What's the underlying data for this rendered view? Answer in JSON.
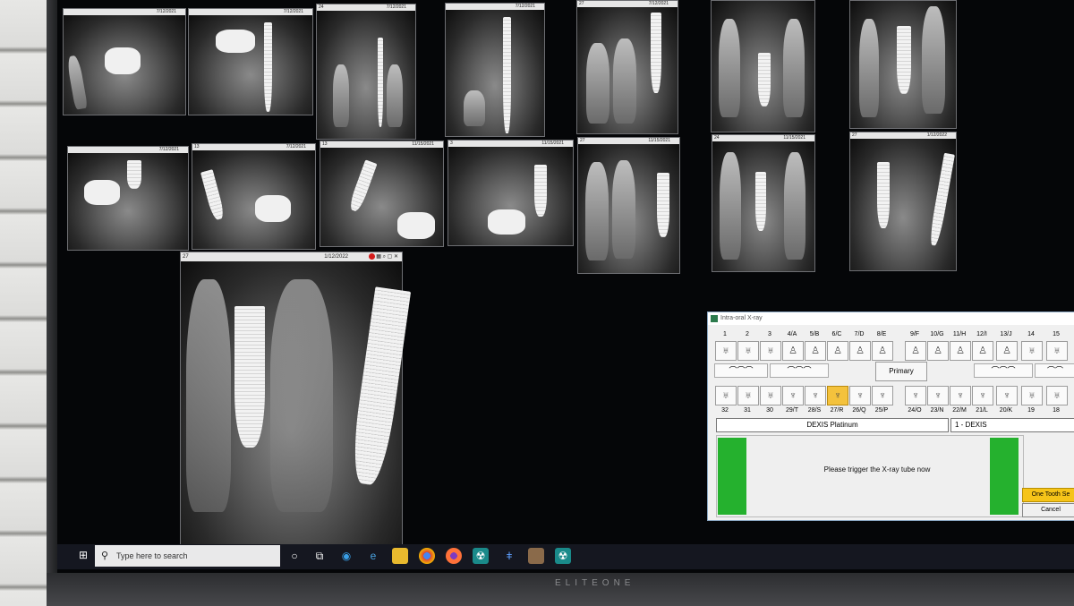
{
  "xrays_top": [
    {
      "tooth": "",
      "date": "7/12/2021"
    },
    {
      "tooth": "",
      "date": "7/12/2021"
    },
    {
      "tooth": "24",
      "date": "7/12/2021"
    },
    {
      "tooth": "",
      "date": "7/12/2021"
    },
    {
      "tooth": "27",
      "date": "7/12/2021"
    },
    {
      "tooth": "",
      "date": ""
    },
    {
      "tooth": "",
      "date": ""
    }
  ],
  "xrays_mid": [
    {
      "tooth": "",
      "date": "7/12/2021"
    },
    {
      "tooth": "13",
      "date": "7/12/2021"
    },
    {
      "tooth": "13",
      "date": "11/15/2021"
    },
    {
      "tooth": "3",
      "date": "11/15/2021"
    },
    {
      "tooth": "27",
      "date": "11/15/2021"
    },
    {
      "tooth": "24",
      "date": "11/15/2021"
    },
    {
      "tooth": "27",
      "date": "1/12/2022"
    }
  ],
  "xray_large": {
    "tooth": "27",
    "date": "1/12/2022"
  },
  "dialog": {
    "title": "Intra-oral X-ray",
    "upper_numbers": [
      "1",
      "2",
      "3",
      "4/A",
      "5/B",
      "6/C",
      "7/D",
      "8/E",
      "9/F",
      "10/G",
      "11/H",
      "12/I",
      "13/J",
      "14",
      "15"
    ],
    "lower_numbers": [
      "32",
      "31",
      "30",
      "29/T",
      "28/S",
      "27/R",
      "26/Q",
      "25/P",
      "24/O",
      "23/N",
      "22/M",
      "21/L",
      "20/K",
      "19",
      "18"
    ],
    "selected_tooth": "27/R",
    "primary_label": "Primary",
    "sensor": "DEXIS Platinum",
    "device": "1 - DEXIS",
    "message": "Please trigger the X-ray tube now",
    "btn_one_tooth": "One Tooth Se",
    "btn_cancel": "Cancel"
  },
  "taskbar": {
    "search_placeholder": "Type here to search"
  },
  "monitor_brand": "ELITEONE",
  "colors": {
    "ready_indicator": "#25b12e",
    "selected_tooth": "#f4c23c",
    "taskbar": "#151720"
  }
}
